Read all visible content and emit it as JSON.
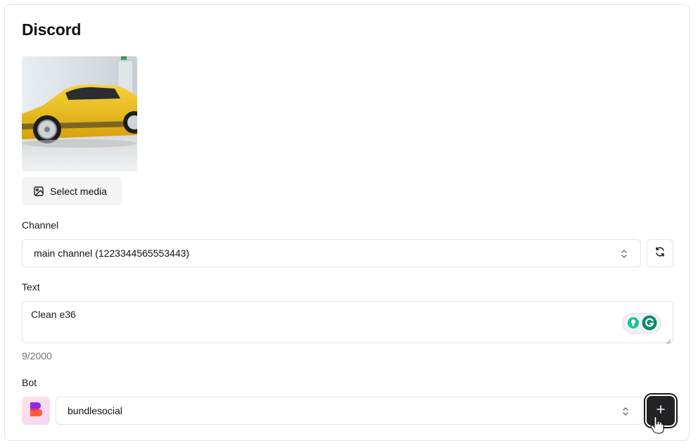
{
  "card": {
    "title": "Discord"
  },
  "media": {
    "select_label": "Select media",
    "thumbnail_alt": "Yellow car"
  },
  "channel": {
    "label": "Channel",
    "selected": "main channel (1223344565553443)"
  },
  "text": {
    "label": "Text",
    "value": "Clean e36",
    "counter": "9/2000"
  },
  "bot": {
    "label": "Bot",
    "selected": "bundlesocial"
  },
  "icons": {
    "image": "image-icon",
    "chevrons": "chevrons-up-down-icon",
    "refresh": "refresh-icon",
    "plus": "plus-icon",
    "grammarly": "grammarly-icon",
    "bulb": "lightbulb-icon",
    "avatar": "bundlesocial-logo"
  },
  "colors": {
    "primary_button": "#232326",
    "border": "#e4e4e7",
    "muted_text": "#71717a",
    "grammarly_green": "#15c39a"
  }
}
